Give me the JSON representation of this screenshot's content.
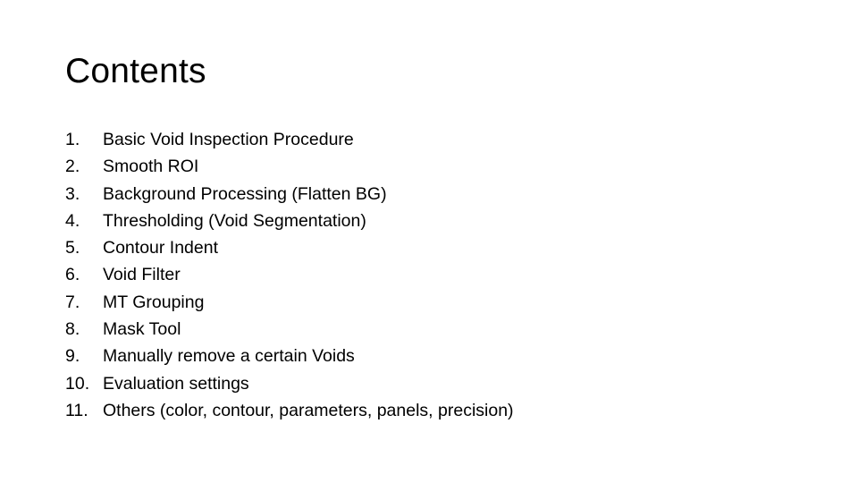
{
  "slide": {
    "title": "Contents",
    "items": [
      {
        "number": "1.",
        "label": "Basic Void Inspection Procedure"
      },
      {
        "number": "2.",
        "label": "Smooth ROI"
      },
      {
        "number": "3.",
        "label": "Background Processing (Flatten BG)"
      },
      {
        "number": "4.",
        "label": "Thresholding (Void Segmentation)"
      },
      {
        "number": "5.",
        "label": "Contour Indent"
      },
      {
        "number": "6.",
        "label": "Void Filter"
      },
      {
        "number": "7.",
        "label": "MT Grouping"
      },
      {
        "number": "8.",
        "label": "Mask Tool"
      },
      {
        "number": "9.",
        "label": "Manually remove a certain Voids"
      },
      {
        "number": "10.",
        "label": "Evaluation settings"
      },
      {
        "number": "11.",
        "label": "Others (color, contour, parameters, panels, precision)"
      }
    ]
  }
}
